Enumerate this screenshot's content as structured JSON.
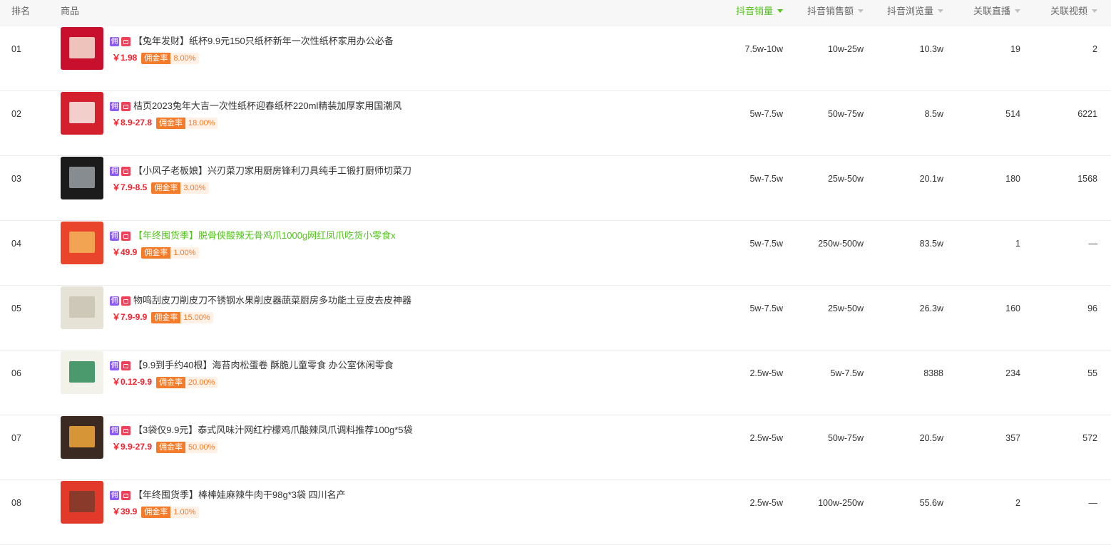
{
  "header": {
    "rank": "排名",
    "product": "商品",
    "sales": "抖音销量",
    "revenue": "抖音销售额",
    "views": "抖音浏览量",
    "live": "关联直播",
    "video": "关联视频"
  },
  "badges": {
    "yong": "佣",
    "commission_label": "佣金率"
  },
  "rows": [
    {
      "rank": "01",
      "title": "【兔年发财】纸杯9.9元150只纸杯新年一次性纸杯家用办公必备",
      "price": "￥1.98",
      "commission": "8.00%",
      "sales": "7.5w-10w",
      "revenue": "10w-25w",
      "views": "10.3w",
      "live": "19",
      "video": "2",
      "thumb_bg": "#c8102e",
      "thumb_fg": "#f3e3d3"
    },
    {
      "rank": "02",
      "title": "桔页2023兔年大吉一次性纸杯迎春纸杯220ml精装加厚家用国潮风",
      "price": "￥8.9-27.8",
      "commission": "18.00%",
      "sales": "5w-7.5w",
      "revenue": "50w-75w",
      "views": "8.5w",
      "live": "514",
      "video": "6221",
      "thumb_bg": "#d3202c",
      "thumb_fg": "#f7efe6"
    },
    {
      "rank": "03",
      "title": "【小风子老板娘】兴刃菜刀家用厨房锋利刀具纯手工锻打厨师切菜刀",
      "price": "￥7.9-8.5",
      "commission": "3.00%",
      "sales": "5w-7.5w",
      "revenue": "25w-50w",
      "views": "20.1w",
      "live": "180",
      "video": "1568",
      "thumb_bg": "#1b1b1b",
      "thumb_fg": "#9aa0a6"
    },
    {
      "rank": "04",
      "title": "【年终囤货季】脱骨侠酸辣无骨鸡爪1000g网红凤爪吃货小零食x",
      "price": "￥49.9",
      "commission": "1.00%",
      "sales": "5w-7.5w",
      "revenue": "250w-500w",
      "views": "83.5w",
      "live": "1",
      "video": "—",
      "thumb_bg": "#e8452c",
      "thumb_fg": "#f5b55a",
      "highlight": true
    },
    {
      "rank": "05",
      "title": "物鸣刮皮刀削皮刀不锈钢水果削皮器蔬菜厨房多功能土豆皮去皮神器",
      "price": "￥7.9-9.9",
      "commission": "15.00%",
      "sales": "5w-7.5w",
      "revenue": "25w-50w",
      "views": "26.3w",
      "live": "160",
      "video": "96",
      "thumb_bg": "#e7e2d6",
      "thumb_fg": "#c9c3b3"
    },
    {
      "rank": "06",
      "title": "【9.9到手约40根】海苔肉松蛋卷 酥脆儿童零食 办公室休闲零食",
      "price": "￥0.12-9.9",
      "commission": "20.00%",
      "sales": "2.5w-5w",
      "revenue": "5w-7.5w",
      "views": "8388",
      "live": "234",
      "video": "55",
      "thumb_bg": "#f2f2ea",
      "thumb_fg": "#2e8b57"
    },
    {
      "rank": "07",
      "title": "【3袋仅9.9元】泰式风味汁网红柠檬鸡爪酸辣凤爪调料推荐100g*5袋",
      "price": "￥9.9-27.9",
      "commission": "50.00%",
      "sales": "2.5w-5w",
      "revenue": "50w-75w",
      "views": "20.5w",
      "live": "357",
      "video": "572",
      "thumb_bg": "#3a2a22",
      "thumb_fg": "#f2a93b"
    },
    {
      "rank": "08",
      "title": "【年终囤货季】棒棒娃麻辣牛肉干98g*3袋 四川名产",
      "price": "￥39.9",
      "commission": "1.00%",
      "sales": "2.5w-5w",
      "revenue": "100w-250w",
      "views": "55.6w",
      "live": "2",
      "video": "—",
      "thumb_bg": "#e23a2a",
      "thumb_fg": "#7a3b2a"
    }
  ]
}
